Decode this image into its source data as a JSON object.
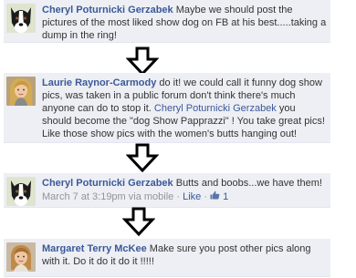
{
  "comments": [
    {
      "name": "Cheryl Poturnicki Gerzabek",
      "text": " Maybe we should post the pictures of the most liked show dog on FB at his best.....taking a dump in the ring!"
    },
    {
      "name": "Laurie Raynor-Carmody",
      "text_1": " do it! we could call it funny dog show pics, was taken in a public forum don't think there's much anyone can do to stop it. ",
      "mention": "Cheryl Poturnicki Gerzabek",
      "text_2": " you should become the \"dog Show Papprazzi\" ! You take great pics! Like those show pics with the women's butts hanging out!"
    },
    {
      "name": "Cheryl Poturnicki Gerzabek",
      "text": " Butts and boobs...we have them!",
      "meta_time": "March 7 at 3:19pm via mobile",
      "meta_sep": " · ",
      "like_link": "Like",
      "like_count": "1"
    },
    {
      "name": "Margaret Terry McKee",
      "text": " Make sure you post other pics along with it. Do it do it do it !!!!!"
    }
  ],
  "icons": {
    "arrow": "down-arrow-icon",
    "like": "thumbs-up-icon"
  },
  "colors": {
    "link": "#3b5998",
    "comment_bg": "#edeff4"
  }
}
